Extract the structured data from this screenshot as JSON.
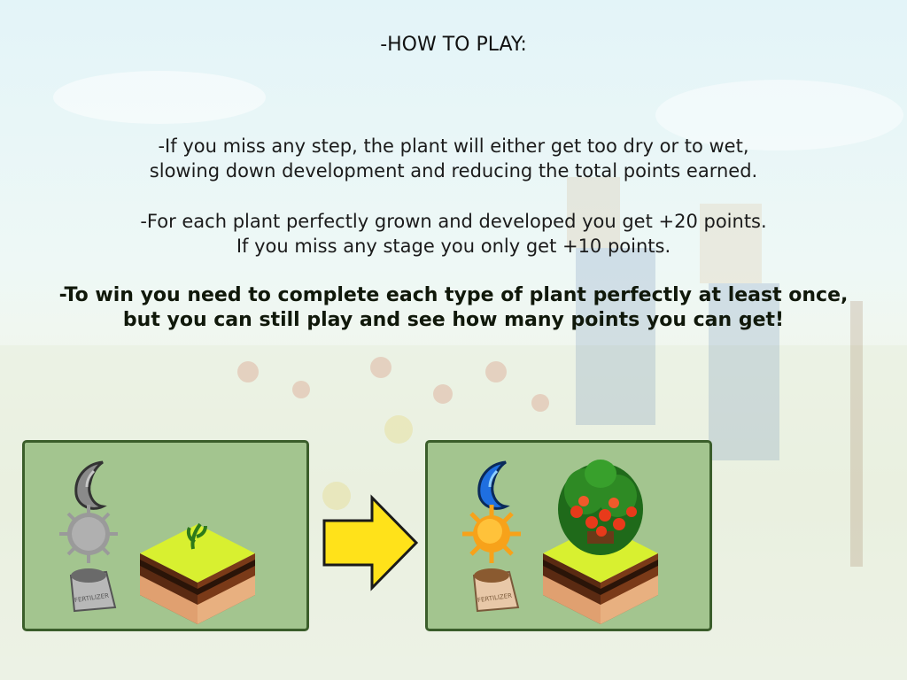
{
  "title": "-HOW TO PLAY:",
  "paragraphs": {
    "p1_line1": "-If you miss any step, the plant will either get too dry or to wet,",
    "p1_line2": "slowing down development and reducing the total points earned.",
    "p2_line1": "-For each plant perfectly grown and developed you get +20 points.",
    "p2_line2": "If you miss any stage you only get +10 points.",
    "p3_line1": "-To win you need to complete each type of plant perfectly at least once,",
    "p3_line2": "but you can still play and see how many points you can get!"
  },
  "illustration": {
    "before": {
      "icons": [
        "water-drop-icon",
        "sun-icon",
        "fertilizer-bag-icon"
      ],
      "state": "inactive (grey)",
      "bag_label": "FERTILIZER",
      "plant": "sprout"
    },
    "arrow": "right-arrow-icon",
    "after": {
      "icons": [
        "water-drop-icon",
        "sun-icon",
        "fertilizer-bag-icon"
      ],
      "state": "active (colored)",
      "bag_label": "FERTILIZER",
      "plant": "tomato plant"
    }
  },
  "colors": {
    "panel_bg": "#a3c58f",
    "panel_border": "#3b5e2b",
    "arrow_fill": "#ffe21a",
    "water_active": "#1f6fe0",
    "sun_active": "#f7a21a"
  }
}
